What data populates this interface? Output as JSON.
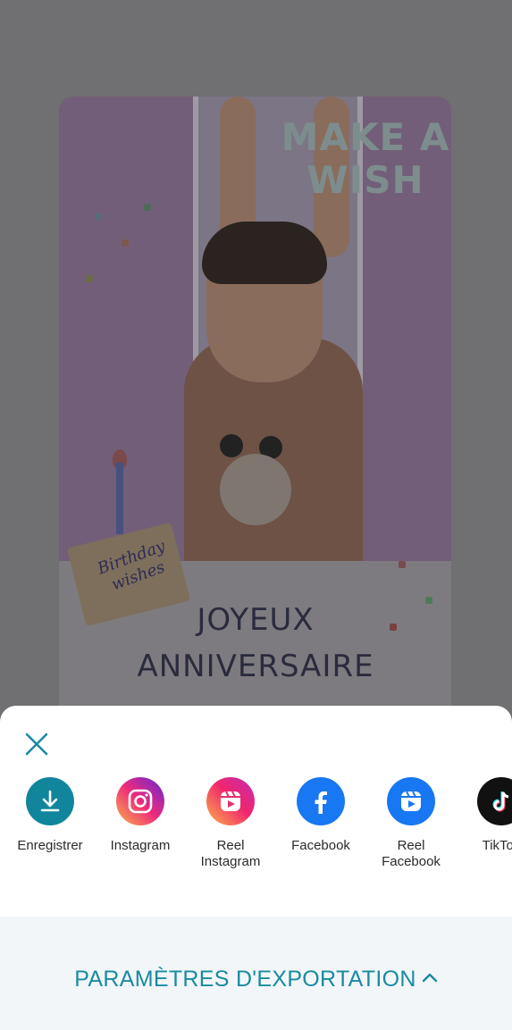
{
  "preview": {
    "sticker_text_line1": "MAKE A",
    "sticker_text_line2": "WISH",
    "cake_label": "Birthday wishes",
    "title_line1": "JOYEUX",
    "title_line2": "ANNIVERSAIRE"
  },
  "sheet": {
    "close_icon": "close-icon",
    "share_targets": [
      {
        "label": "Enregistrer",
        "icon": "download-icon",
        "color": "#11859b"
      },
      {
        "label": "Instagram",
        "icon": "instagram-icon",
        "color": "#c13584"
      },
      {
        "label": "Reel\nInstagram",
        "icon": "reel-instagram-icon",
        "color": "#e1306c"
      },
      {
        "label": "Facebook",
        "icon": "facebook-icon",
        "color": "#1877f2"
      },
      {
        "label": "Reel\nFacebook",
        "icon": "reel-facebook-icon",
        "color": "#1877f2"
      },
      {
        "label": "TikTok",
        "icon": "tiktok-icon",
        "color": "#111111"
      }
    ],
    "export_settings_label": "PARAMÈTRES D'EXPORTATION"
  },
  "colors": {
    "accent": "#1a8ba0",
    "export_bar_bg": "#f2f6f9"
  }
}
